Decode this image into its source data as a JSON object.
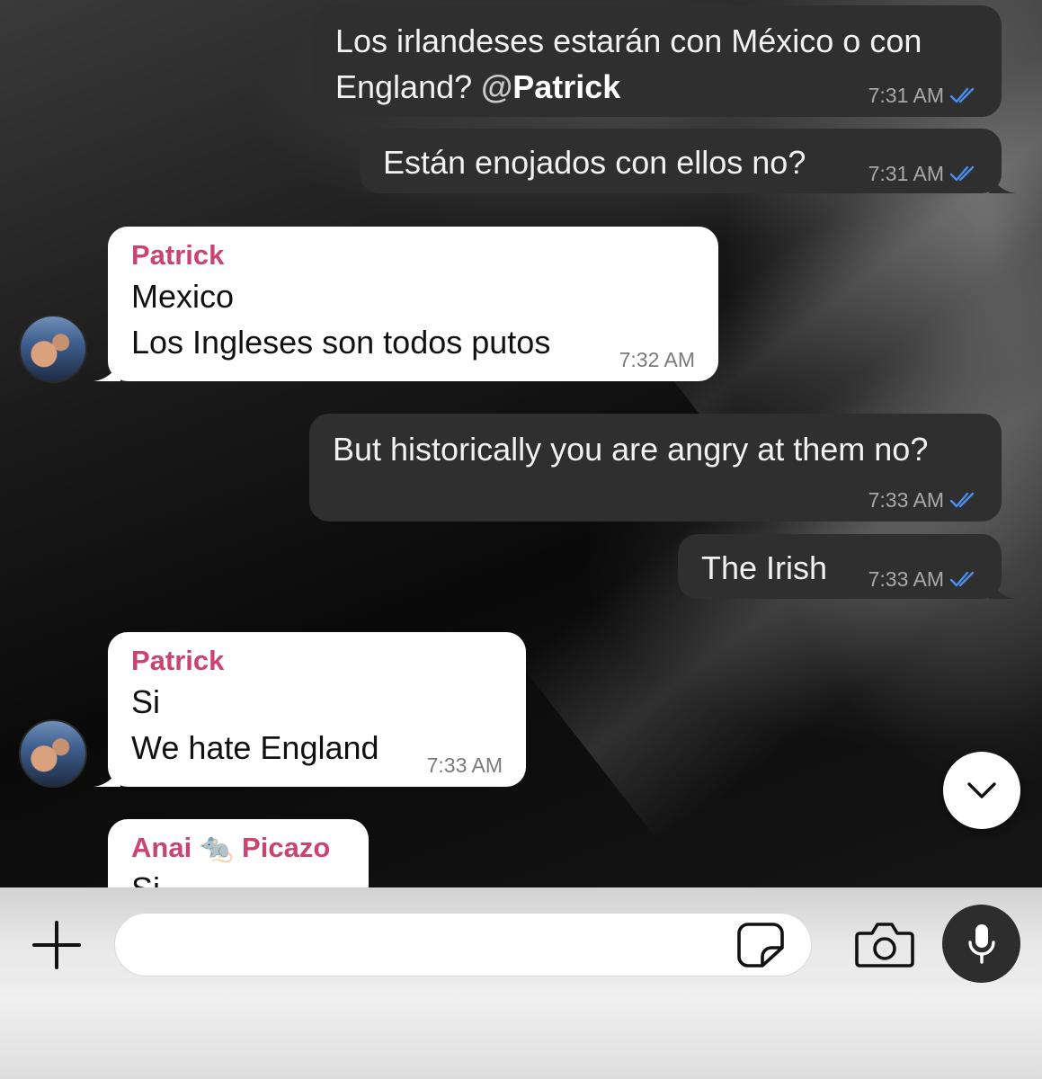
{
  "messages": [
    {
      "direction": "outgoing",
      "line1": "Los irlandeses estarán con México o con",
      "line2_prefix": "England? ",
      "mention_at": "@",
      "mention_name": "Patrick",
      "time": "7:31 AM",
      "status": "read"
    },
    {
      "direction": "outgoing",
      "text": "Están enojados con ellos no?",
      "time": "7:31 AM",
      "status": "read"
    },
    {
      "direction": "incoming",
      "sender": "Patrick",
      "line1": "Mexico",
      "line2": "Los Ingleses son todos putos",
      "time": "7:32 AM"
    },
    {
      "direction": "outgoing",
      "text": "But historically you are angry at them no?",
      "time": "7:33 AM",
      "status": "read"
    },
    {
      "direction": "outgoing",
      "text": "The Irish",
      "time": "7:33 AM",
      "status": "read"
    },
    {
      "direction": "incoming",
      "sender": "Patrick",
      "line1": "Si",
      "line2": "We hate England",
      "time": "7:33 AM"
    },
    {
      "direction": "incoming",
      "sender_first": "Anai",
      "sender_emoji": "🐀",
      "sender_last": "Picazo",
      "partial_text": "Si"
    }
  ],
  "composer": {
    "placeholder": "",
    "value": ""
  },
  "icons": {
    "attach": "plus-icon",
    "sticker": "sticker-icon",
    "camera": "camera-icon",
    "mic": "microphone-icon",
    "scroll": "chevron-down-icon",
    "read_receipt": "double-check-icon"
  },
  "colors": {
    "outgoing_bubble": "#2f2f2f",
    "incoming_bubble": "#ffffff",
    "sender_name": "#c9456f",
    "read_ticks": "#4a8ef0"
  }
}
